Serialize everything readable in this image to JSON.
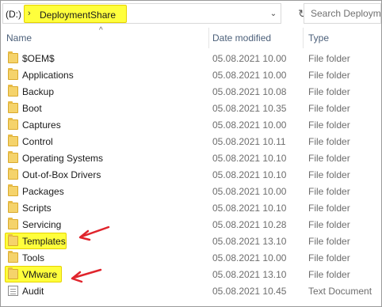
{
  "address": {
    "drive": "(D:)",
    "crumb_chevron": "›",
    "folder": "DeploymentShare",
    "dropdown": "⌄",
    "refresh": "↻"
  },
  "search": {
    "placeholder": "Search Deployme"
  },
  "columns": {
    "name": "Name",
    "date": "Date modified",
    "type": "Type"
  },
  "rows": [
    {
      "name": "$OEM$",
      "date": "05.08.2021 10.00",
      "type": "File folder",
      "icon": "folder-icon",
      "highlight": false
    },
    {
      "name": "Applications",
      "date": "05.08.2021 10.00",
      "type": "File folder",
      "icon": "folder-icon",
      "highlight": false
    },
    {
      "name": "Backup",
      "date": "05.08.2021 10.08",
      "type": "File folder",
      "icon": "folder-icon",
      "highlight": false
    },
    {
      "name": "Boot",
      "date": "05.08.2021 10.35",
      "type": "File folder",
      "icon": "folder-icon",
      "highlight": false
    },
    {
      "name": "Captures",
      "date": "05.08.2021 10.00",
      "type": "File folder",
      "icon": "folder-icon",
      "highlight": false
    },
    {
      "name": "Control",
      "date": "05.08.2021 10.11",
      "type": "File folder",
      "icon": "folder-icon",
      "highlight": false
    },
    {
      "name": "Operating Systems",
      "date": "05.08.2021 10.10",
      "type": "File folder",
      "icon": "folder-icon",
      "highlight": false
    },
    {
      "name": "Out-of-Box Drivers",
      "date": "05.08.2021 10.10",
      "type": "File folder",
      "icon": "folder-icon",
      "highlight": false
    },
    {
      "name": "Packages",
      "date": "05.08.2021 10.00",
      "type": "File folder",
      "icon": "folder-icon",
      "highlight": false
    },
    {
      "name": "Scripts",
      "date": "05.08.2021 10.10",
      "type": "File folder",
      "icon": "folder-icon",
      "highlight": false
    },
    {
      "name": "Servicing",
      "date": "05.08.2021 10.28",
      "type": "File folder",
      "icon": "folder-icon",
      "highlight": false
    },
    {
      "name": "Templates",
      "date": "05.08.2021 13.10",
      "type": "File folder",
      "icon": "folder-icon",
      "highlight": true
    },
    {
      "name": "Tools",
      "date": "05.08.2021 10.00",
      "type": "File folder",
      "icon": "folder-icon",
      "highlight": false
    },
    {
      "name": "VMware",
      "date": "05.08.2021 13.10",
      "type": "File folder",
      "icon": "folder-icon",
      "highlight": true
    },
    {
      "name": "Audit",
      "date": "05.08.2021 10.45",
      "type": "Text Document",
      "icon": "text-document-icon",
      "highlight": false
    }
  ],
  "colors": {
    "highlight": "#ffff3c",
    "arrow": "#e0242c",
    "header_text": "#4c607a"
  }
}
